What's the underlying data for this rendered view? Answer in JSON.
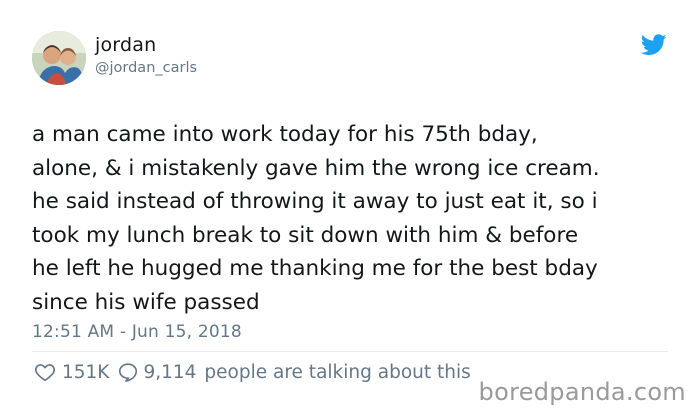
{
  "author": {
    "display_name": "jordan",
    "handle": "@jordan_carls",
    "avatar_icon": "user-avatar-photo"
  },
  "brand": {
    "icon": "twitter-bird-icon",
    "color": "#1da1f2"
  },
  "tweet": {
    "lines": [
      "a man came into work today for his 75th bday,",
      "alone, & i mistakenly gave him the wrong ice cream.",
      "he said instead of throwing it away to just eat it, so i",
      "took my lunch break to sit down with him & before",
      "he left he hugged me thanking me for the best bday",
      "since his wife passed"
    ],
    "timestamp": "12:51 AM - Jun 15, 2018"
  },
  "engagement": {
    "likes": "151K",
    "likes_icon": "heart-icon",
    "replies": "9,114",
    "replies_icon": "speech-bubble-icon",
    "talking_text": "people are talking about this"
  },
  "watermark": "boredpanda.com",
  "colors": {
    "text": "#14171a",
    "secondary": "#657786",
    "watermark": "#9a9a9a"
  }
}
